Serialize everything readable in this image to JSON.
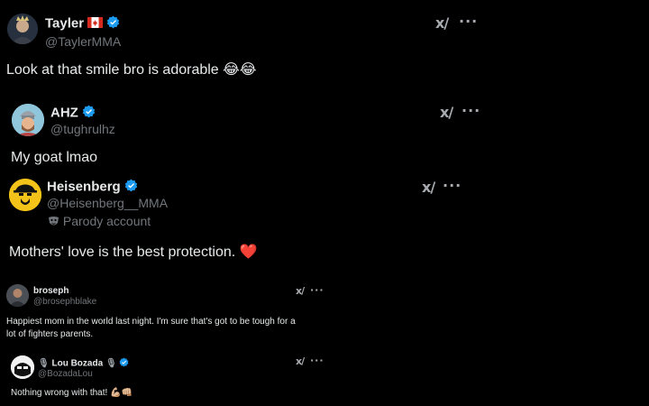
{
  "posts": [
    {
      "name": "Tayler",
      "handle": "@TaylerMMA",
      "text": "Look at that smile bro is adorable 😂😂",
      "grok": "x/",
      "more": "···"
    },
    {
      "name": "AHZ",
      "handle": "@tughrulhz",
      "text": "My goat lmao",
      "grok": "x/",
      "more": "···"
    },
    {
      "name": "Heisenberg",
      "handle": "@Heisenberg__MMA",
      "label": "Parody account",
      "text": "Mothers' love is the best protection. ❤️",
      "grok": "x/",
      "more": "···"
    },
    {
      "name": "broseph",
      "handle": "@brosephblake",
      "text_line1": "Happiest mom in the world last night. I'm sure that's got to be tough for a",
      "text_line2": "lot of fighters parents.",
      "grok": "x/",
      "more": "···"
    },
    {
      "name": "Lou Bozada",
      "handle": "@BozadaLou",
      "text": "Nothing wrong with that! 💪🏼👊🏼",
      "grok": "x/",
      "more": "···"
    }
  ],
  "colors": {
    "background": "#000000",
    "text": "#e7e9ea",
    "secondary": "#71767b",
    "verified": "#1d9bf0",
    "heart": "#f91880"
  }
}
